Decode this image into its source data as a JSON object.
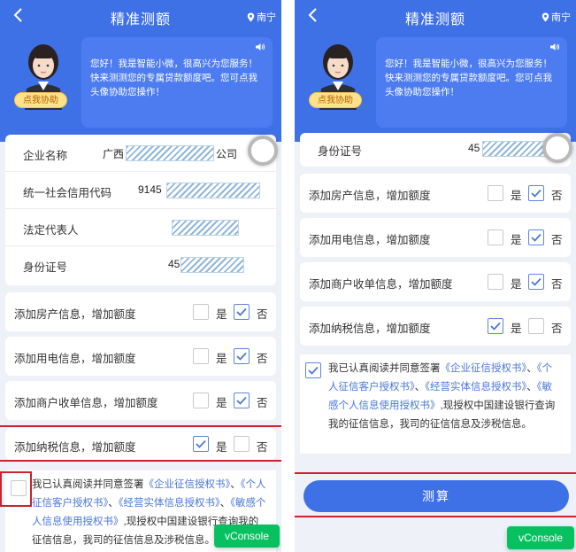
{
  "colors": {
    "primary": "#3f71e6",
    "bubble": "#4c7cf0",
    "alert_red": "#c9232b",
    "link": "#4a78d8",
    "vconsole": "#07c160"
  },
  "header": {
    "title": "精准测额",
    "location": "南宁",
    "back_icon": "chevron-left-icon",
    "location_icon": "location-pin-icon"
  },
  "assistant": {
    "button_label": "点我协助",
    "message": "您好！我是智能小微，很高兴为您服务！快来测测您的专属贷款额度吧。您可点我头像协助您操作！"
  },
  "left": {
    "company_form": [
      {
        "label": "企业名称",
        "value_prefix": "广西",
        "value_suffix": "公司"
      },
      {
        "label": "统一社会信用代码",
        "value_prefix": "9145",
        "value_suffix": ""
      },
      {
        "label": "法定代表人",
        "value_prefix": "",
        "value_suffix": ""
      },
      {
        "label": "身份证号",
        "value_prefix": "45",
        "value_suffix": ""
      }
    ],
    "options": [
      {
        "label": "添加房产信息，增加额度",
        "yes": "是",
        "no": "否",
        "selected": "no"
      },
      {
        "label": "添加用电信息，增加额度",
        "yes": "是",
        "no": "否",
        "selected": "no"
      },
      {
        "label": "添加商户收单信息，增加额度",
        "yes": "是",
        "no": "否",
        "selected": "no"
      },
      {
        "label": "添加纳税信息，增加额度",
        "yes": "是",
        "no": "否",
        "selected": "yes"
      }
    ],
    "agreement_checked": false
  },
  "right": {
    "id_field": {
      "label": "身份证号",
      "value_prefix": "45"
    },
    "options": [
      {
        "label": "添加房产信息，增加额度",
        "yes": "是",
        "no": "否",
        "selected": "no"
      },
      {
        "label": "添加用电信息，增加额度",
        "yes": "是",
        "no": "否",
        "selected": "no"
      },
      {
        "label": "添加商户收单信息，增加额度",
        "yes": "是",
        "no": "否",
        "selected": "no"
      },
      {
        "label": "添加纳税信息，增加额度",
        "yes": "是",
        "no": "否",
        "selected": "yes"
      }
    ],
    "agreement_checked": true,
    "submit_label": "测算"
  },
  "agreement": {
    "text_before": "我已认真阅读并同意签署",
    "link1": "《企业征信授权书》",
    "sep1": "、",
    "link2": "《个人征信客户授权书》",
    "sep2": "、",
    "link3": "《经营实体信息授权书》",
    "sep3": "、",
    "link4": "《敏感个人信息使用授权书》",
    "text_after": ",现授权中国建设银行查询我的征信信息，我司的征信信息及涉税信息。"
  },
  "vconsole_label": "vConsole"
}
